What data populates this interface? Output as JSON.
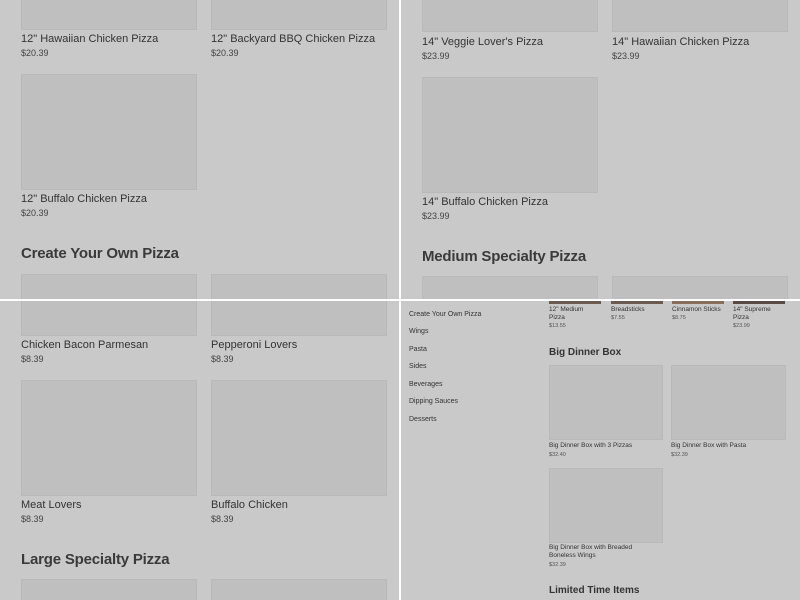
{
  "q1": {
    "items": [
      {
        "name": "12\" Hawaiian Chicken Pizza",
        "price": "$20.39"
      },
      {
        "name": "12\" Backyard BBQ Chicken Pizza",
        "price": "$20.39"
      },
      {
        "name": "12\" Buffalo Chicken Pizza",
        "price": "$20.39"
      }
    ],
    "heading": "Create Your Own Pizza"
  },
  "q2": {
    "items": [
      {
        "name": "14\" Veggie Lover's Pizza",
        "price": "$23.99"
      },
      {
        "name": "14\" Hawaiian Chicken Pizza",
        "price": "$23.99"
      },
      {
        "name": "14\" Buffalo Chicken Pizza",
        "price": "$23.99"
      }
    ],
    "heading": "Medium Specialty Pizza"
  },
  "q3": {
    "items": [
      {
        "name": "Chicken Bacon Parmesan",
        "price": "$8.39"
      },
      {
        "name": "Pepperoni Lovers",
        "price": "$8.39"
      },
      {
        "name": "Meat Lovers",
        "price": "$8.39"
      },
      {
        "name": "Buffalo Chicken",
        "price": "$8.39"
      }
    ],
    "heading": "Large Specialty Pizza"
  },
  "q4": {
    "sidebar": [
      "Create Your Own Pizza",
      "Wings",
      "Pasta",
      "Sides",
      "Beverages",
      "Dipping Sauces",
      "Desserts"
    ],
    "top_items": [
      {
        "name": "12\" Medium Pizza",
        "price": "$13.55"
      },
      {
        "name": "Breadsticks",
        "price": "$7.55"
      },
      {
        "name": "Cinnamon Sticks",
        "price": "$8.75"
      },
      {
        "name": "14\" Supreme Pizza",
        "price": "$23.99"
      }
    ],
    "heading_big": "Big Dinner Box",
    "box_items": [
      {
        "name": "Big Dinner Box with 3 Pizzas",
        "price": "$32.40"
      },
      {
        "name": "Big Dinner Box with Pasta",
        "price": "$32.39"
      },
      {
        "name": "Big Dinner Box with Breaded Boneless Wings",
        "price": "$32.39"
      }
    ],
    "heading_limited": "Limited Time Items"
  }
}
